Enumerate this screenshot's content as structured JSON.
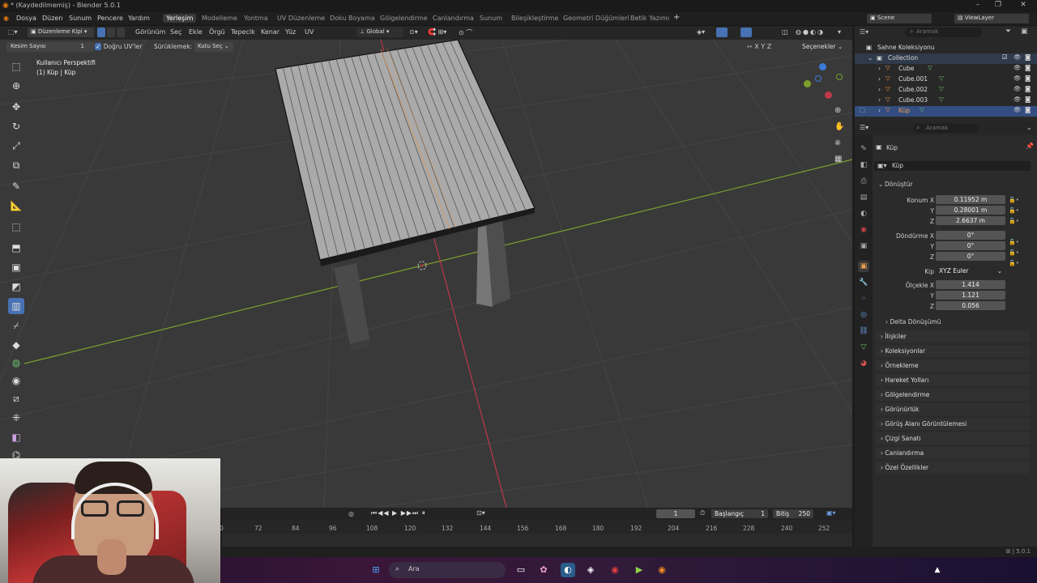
{
  "window": {
    "title": "* (Kaydedilmemiş) - Blender 5.0.1"
  },
  "menu": [
    "Dosya",
    "Düzen",
    "Sunum",
    "Pencere",
    "Yardım"
  ],
  "workspaces": [
    "Yerleşim",
    "Modelleme",
    "Yontma",
    "UV Düzenleme",
    "Doku Boyama",
    "Gölgelendirme",
    "Canlandırma",
    "Sunum",
    "Bileşikleştirme",
    "Geometri Düğümleri",
    "Betik Yazımı"
  ],
  "active_workspace": "Yerleşim",
  "scene": {
    "name": "Scene",
    "view_layer": "ViewLayer"
  },
  "viewport_header": {
    "mode": "Düzenleme Kipi",
    "menus": [
      "Görünüm",
      "Seç",
      "Ekle",
      "Örgü",
      "Tepecik",
      "Kenar",
      "Yüz",
      "UV"
    ],
    "transform": "Global",
    "options": "Seçenekler",
    "axes": [
      "X",
      "Y",
      "Z"
    ]
  },
  "tool_options": {
    "cuts_label": "Kesim Sayısı",
    "cuts_value": "1",
    "uv_label": "Doğru UV'ler",
    "drag_label": "Sürüklemek:",
    "drag_value": "Kutu Seç"
  },
  "viewport_info": {
    "line1": "Kullanıcı Perspektifi",
    "line2": "(1) Küp | Küp"
  },
  "outliner": {
    "search_placeholder": "Aramak",
    "root": "Sahne Koleksiyonu",
    "collection": "Collection",
    "items": [
      "Cube",
      "Cube.001",
      "Cube.002",
      "Cube.003",
      "Küp"
    ],
    "selected": "Küp"
  },
  "properties": {
    "search_placeholder": "Aramak",
    "object_name": "Küp",
    "data_name": "Küp",
    "section": "Dönüştür",
    "location": {
      "label": "Konum X",
      "x": "0.11952 m",
      "y": "0.28001 m",
      "z": "2.6637 m"
    },
    "rotation": {
      "label": "Döndürme X",
      "x": "0°",
      "y": "0°",
      "z": "0°"
    },
    "mode": {
      "label": "Kip",
      "value": "XYZ Euler"
    },
    "scale": {
      "label": "Ölçekle X",
      "x": "1.414",
      "y": "1.121",
      "z": "0.056"
    },
    "axis_y": "Y",
    "axis_z": "Z",
    "panels": [
      "Delta Dönüşümü",
      "İlişkiler",
      "Koleksiyonlar",
      "Örnekleme",
      "Hareket Yolları",
      "Gölgelendirme",
      "Görünürlük",
      "Görüş Alanı Görüntülemesi",
      "Çizgi Sanatı",
      "Canlandırma",
      "Özel Özellikler"
    ]
  },
  "timeline": {
    "current": "1",
    "start_label": "Başlangıç",
    "start": "1",
    "end_label": "Bitiş",
    "end": "250",
    "ticks": [
      "0",
      "72",
      "84",
      "96",
      "108",
      "120",
      "132",
      "144",
      "156",
      "168",
      "180",
      "192",
      "204",
      "216",
      "228",
      "240",
      "252"
    ]
  },
  "statusbar": {
    "version": "5.0.1"
  },
  "taskbar": {
    "search_placeholder": "Ara"
  },
  "colors": {
    "accent": "#4772b3",
    "x_axis": "#c0394a",
    "y_axis": "#7ca02c",
    "selected_row": "#334d80"
  }
}
